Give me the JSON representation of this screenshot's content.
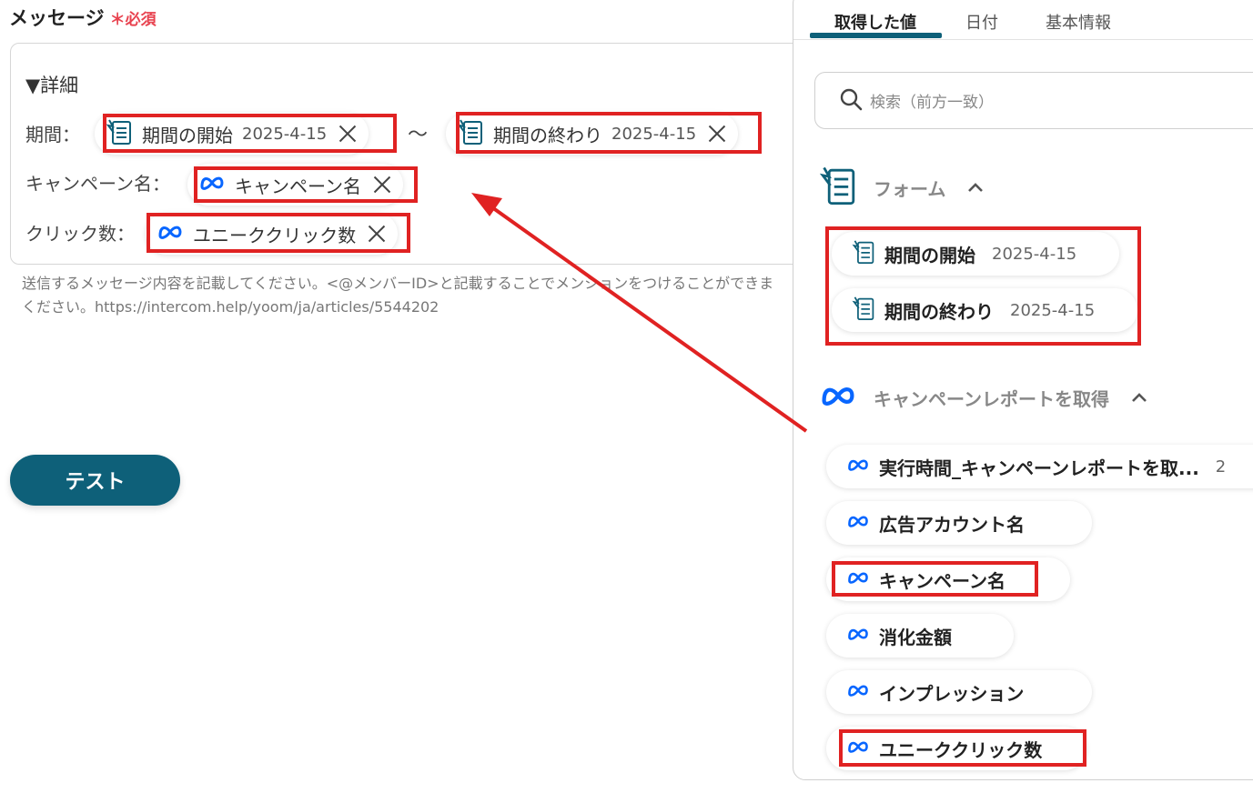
{
  "field": {
    "title": "メッセージ",
    "required": "＊必須"
  },
  "message": {
    "detail": "▼詳細",
    "period_label": "期間：",
    "campaign_label": "キャンペーン名：",
    "click_label": "クリック数：",
    "period_start": {
      "label": "期間の開始",
      "value": "2025-4-15"
    },
    "tilde": "〜",
    "period_end": {
      "label": "期間の終わり",
      "value": "2025-4-15"
    },
    "campaign": {
      "label": "キャンペーン名"
    },
    "clicks": {
      "label": "ユニーククリック数"
    }
  },
  "help": {
    "line1": "送信するメッセージ内容を記載してください。<@メンバーID>と記載することでメンションをつけることができま",
    "line2": "ください。https://intercom.help/yoom/ja/articles/5544202"
  },
  "test_button": "テスト",
  "panel": {
    "tabs": [
      "取得した値",
      "日付",
      "基本情報"
    ],
    "search_placeholder": "検索（前方一致）",
    "sections": [
      {
        "name": "フォーム",
        "items": [
          {
            "label": "期間の開始",
            "value": "2025-4-15"
          },
          {
            "label": "期間の終わり",
            "value": "2025-4-15"
          }
        ]
      },
      {
        "name": "キャンペーンレポートを取得",
        "items": [
          {
            "label": "実行時間_キャンペーンレポートを取...",
            "value": "2"
          },
          {
            "label": "広告アカウント名"
          },
          {
            "label": "キャンペーン名"
          },
          {
            "label": "消化金額"
          },
          {
            "label": "インプレッション"
          },
          {
            "label": "ユニーククリック数"
          }
        ]
      }
    ]
  },
  "colors": {
    "accent": "#0e6079",
    "highlight": "#e02222",
    "required": "#e8424f",
    "meta": "#0866ff"
  },
  "icons": {
    "form": "form-icon",
    "meta": "meta-logo-icon",
    "search": "search-icon",
    "close": "close-icon",
    "chevron": "chevron-up-icon"
  }
}
